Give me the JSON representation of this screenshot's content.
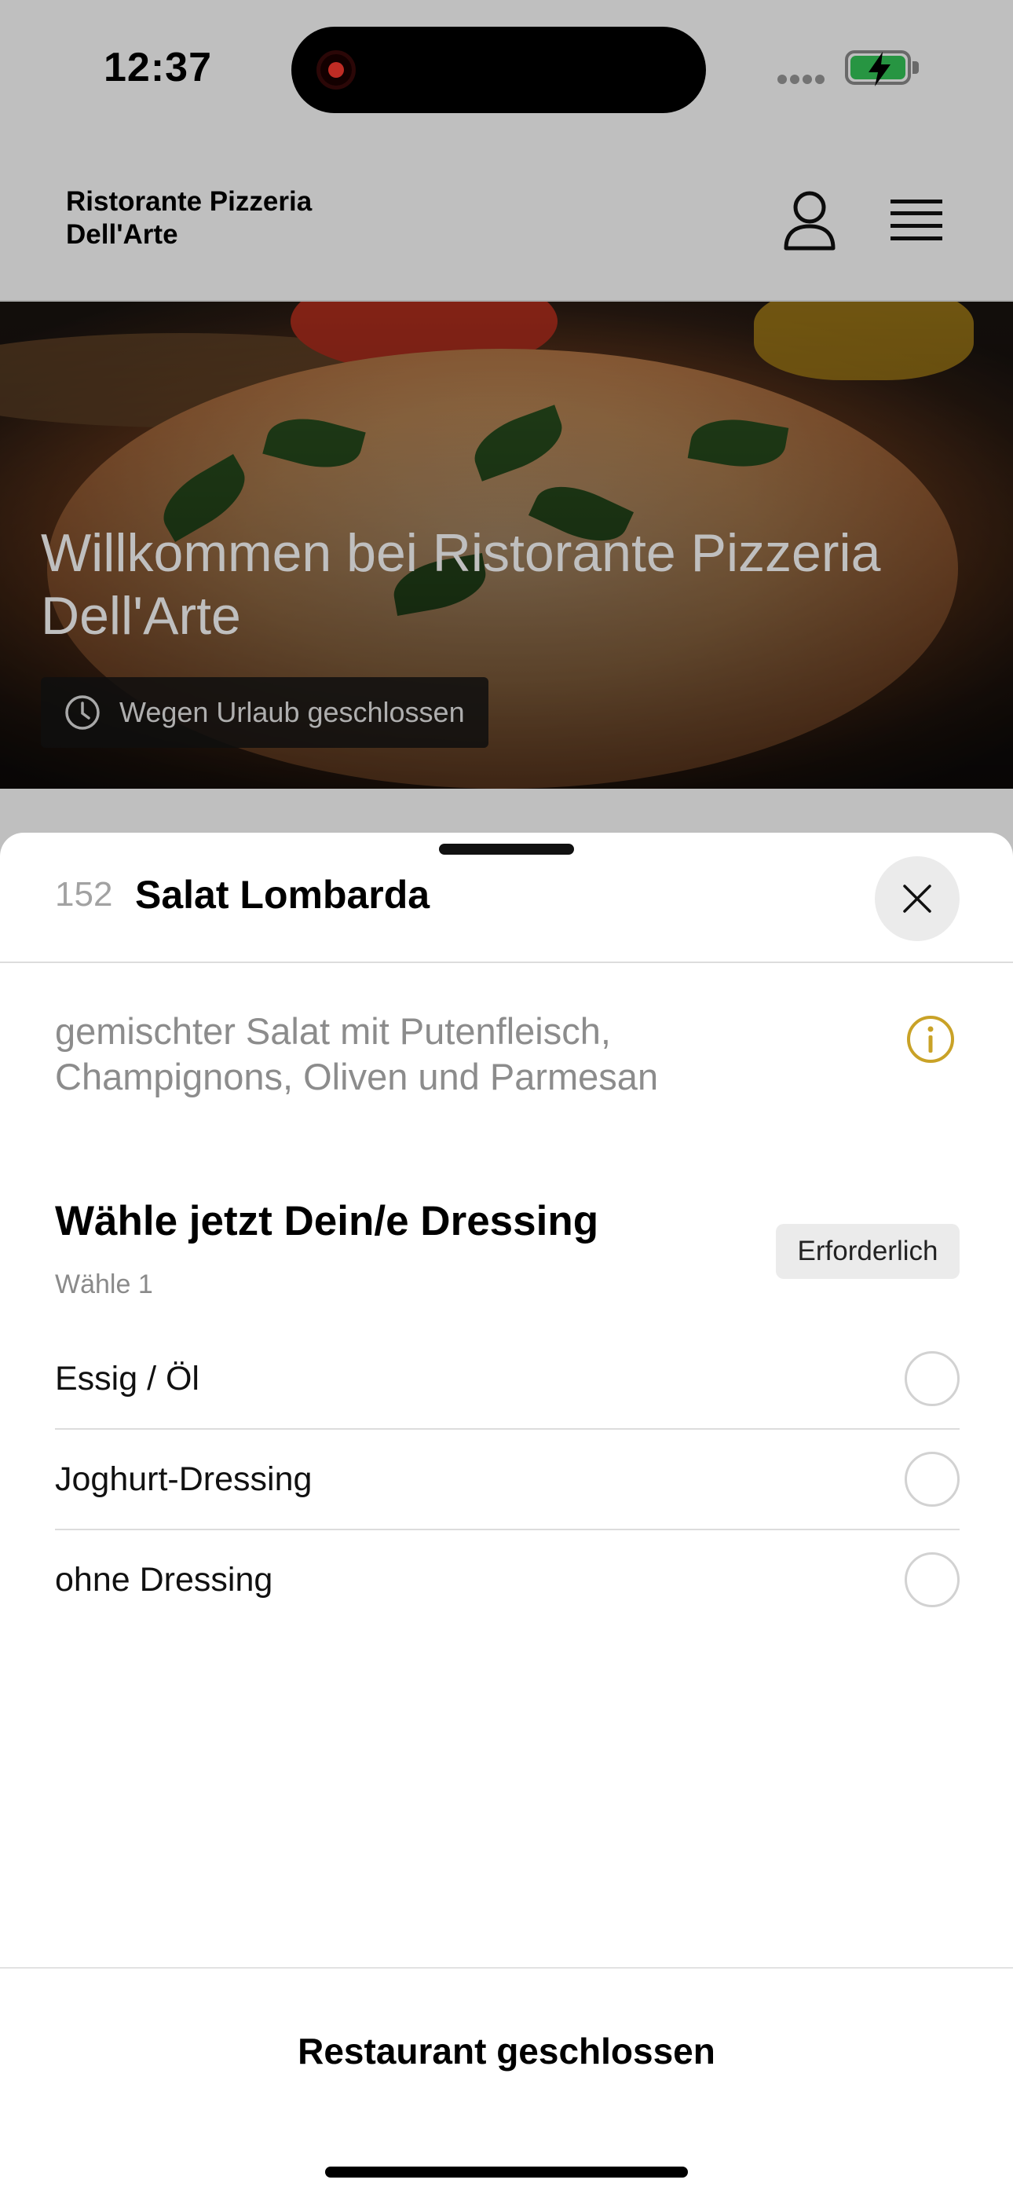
{
  "status_bar": {
    "time": "12:37"
  },
  "app_header": {
    "brand_line1": "Ristorante Pizzeria",
    "brand_line2": "Dell'Arte",
    "icons": [
      "user-icon",
      "menu-icon"
    ]
  },
  "hero": {
    "title": "Willkommen bei Ristorante Pizzeria Dell'Arte",
    "status_chip": "Wegen Urlaub geschlossen"
  },
  "item_sheet": {
    "number": "152",
    "name": "Salat Lombarda",
    "description": "gemischter Salat mit Putenfleisch, Champignons, Oliven und Parmesan",
    "option_group": {
      "title": "Wähle jetzt Dein/e Dressing",
      "subtitle": "Wähle 1",
      "required_label": "Erforderlich",
      "options": [
        {
          "label": "Essig / Öl",
          "selected": false
        },
        {
          "label": "Joghurt-Dressing",
          "selected": false
        },
        {
          "label": "ohne Dressing",
          "selected": false
        }
      ]
    },
    "footer_button": "Restaurant geschlossen"
  },
  "colors": {
    "accent_info": "#c9a227",
    "battery_green": "#34c759",
    "record_red": "#ff3b30"
  }
}
